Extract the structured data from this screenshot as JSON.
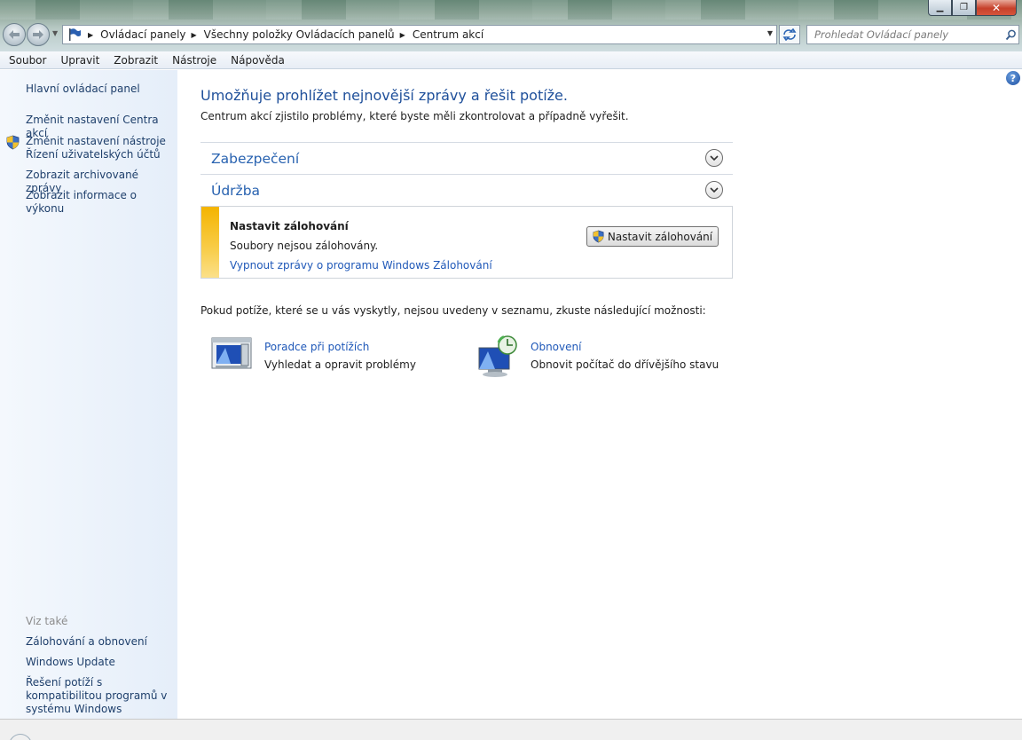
{
  "window": {
    "minimize_glyph": "▁",
    "maximize_glyph": "❐",
    "close_glyph": "✕"
  },
  "address": {
    "crumbs": [
      "Ovládací panely",
      "Všechny položky Ovládacích panelů",
      "Centrum akcí"
    ]
  },
  "search": {
    "placeholder": "Prohledat Ovládací panely"
  },
  "menu": [
    "Soubor",
    "Upravit",
    "Zobrazit",
    "Nástroje",
    "Nápověda"
  ],
  "sidebar": {
    "home": "Hlavní ovládací panel",
    "links": [
      "Změnit nastavení Centra akcí",
      "Změnit nastavení nástroje Řízení uživatelských účtů",
      "Zobrazit archivované zprávy",
      "Zobrazit informace o výkonu"
    ],
    "see_also_label": "Viz také",
    "see_also": [
      "Zálohování a obnovení",
      "Windows Update",
      "Řešení potíží s kompatibilitou programů v systému Windows"
    ]
  },
  "main": {
    "heading": "Umožňuje prohlížet nejnovější zprávy a řešit potíže.",
    "subtext": "Centrum akcí zjistilo problémy, které byste měli zkontrolovat a případně vyřešit.",
    "sections": [
      "Zabezpečení",
      "Údržba"
    ],
    "message": {
      "title": "Nastavit zálohování",
      "text": "Soubory nejsou zálohovány.",
      "link": "Vypnout zprávy o programu Windows Zálohování",
      "button": "Nastavit zálohování"
    },
    "if_not_listed": "Pokud potíže, které se u vás vyskytly, nejsou uvedeny v seznamu, zkuste následující možnosti:",
    "options": [
      {
        "title": "Poradce při potížích",
        "desc": "Vyhledat a opravit problémy",
        "icon": "troubleshoot-icon"
      },
      {
        "title": "Obnovení",
        "desc": "Obnovit počítač do dřívějšího stavu",
        "icon": "system-restore-icon"
      }
    ]
  },
  "colors": {
    "link": "#1f58b8",
    "heading": "#1e4f9a",
    "warning_stripe": "#f4b400"
  }
}
